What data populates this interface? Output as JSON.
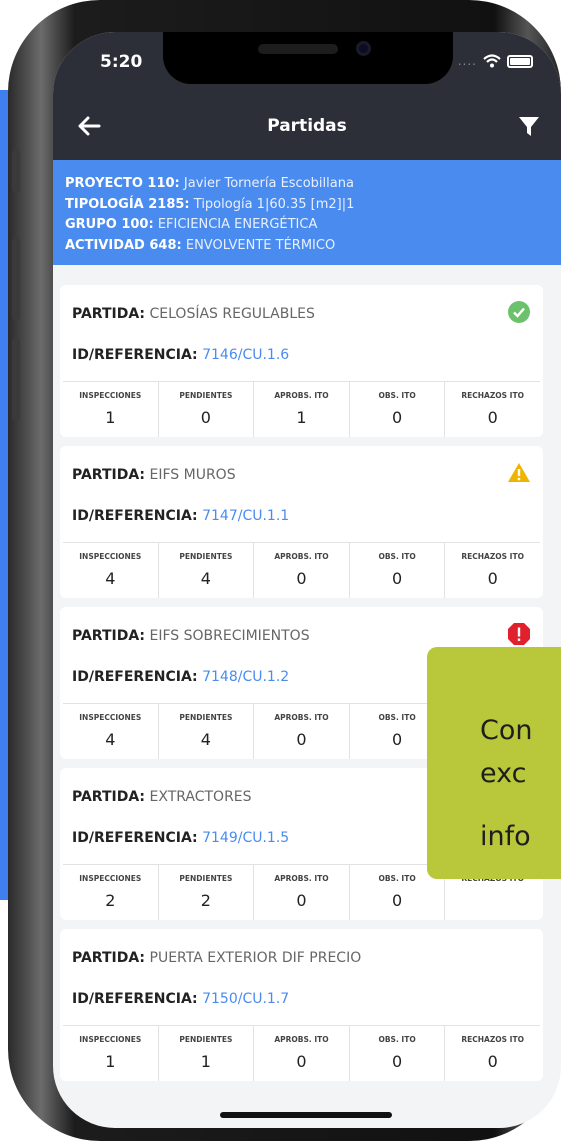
{
  "statusbar": {
    "time": "5:20",
    "signal": "...."
  },
  "navbar": {
    "title": "Partidas"
  },
  "project": [
    {
      "label": "PROYECTO 110:",
      "value": "Javier Tornería Escobillana"
    },
    {
      "label": "TIPOLOGÍA 2185:",
      "value": "Tipología 1|60.35 [m2]|1"
    },
    {
      "label": "GRUPO 100:",
      "value": "EFICIENCIA ENERGÉTICA"
    },
    {
      "label": "ACTIVIDAD 648:",
      "value": "ENVOLVENTE TÉRMICO"
    }
  ],
  "labels": {
    "partida": "PARTIDA:",
    "referencia": "ID/REFERENCIA:"
  },
  "stat_headers": [
    "INSPECCIONES",
    "PENDIENTES",
    "APROBS. ITO",
    "OBS. ITO",
    "RECHAZOS ITO"
  ],
  "partidas": [
    {
      "name": "CELOSÍAS REGULABLES",
      "ref": "7146/CU.1.6",
      "status": "ok-check-icon",
      "stats": [
        "1",
        "0",
        "1",
        "0",
        "0"
      ]
    },
    {
      "name": "EIFS MUROS",
      "ref": "7147/CU.1.1",
      "status": "warning-icon",
      "stats": [
        "4",
        "4",
        "0",
        "0",
        "0"
      ]
    },
    {
      "name": "EIFS SOBRECIMIENTOS",
      "ref": "7148/CU.1.2",
      "status": "error-icon",
      "stats": [
        "4",
        "4",
        "0",
        "0",
        ""
      ]
    },
    {
      "name": "EXTRACTORES",
      "ref": "7149/CU.1.5",
      "status": "",
      "stats": [
        "2",
        "2",
        "0",
        "0",
        ""
      ]
    },
    {
      "name": "PUERTA EXTERIOR DIF PRECIO",
      "ref": "7150/CU.1.7",
      "status": "",
      "stats": [
        "1",
        "1",
        "0",
        "0",
        "0"
      ]
    }
  ],
  "callout": {
    "lines": [
      "Con",
      "exc",
      "info"
    ]
  },
  "colors": {
    "header_blue": "#4a8bf0",
    "navbar": "#2c2f38",
    "ok": "#6cc26c",
    "warning": "#f0b400",
    "error": "#e0202c",
    "callout": "#b9c83a"
  }
}
